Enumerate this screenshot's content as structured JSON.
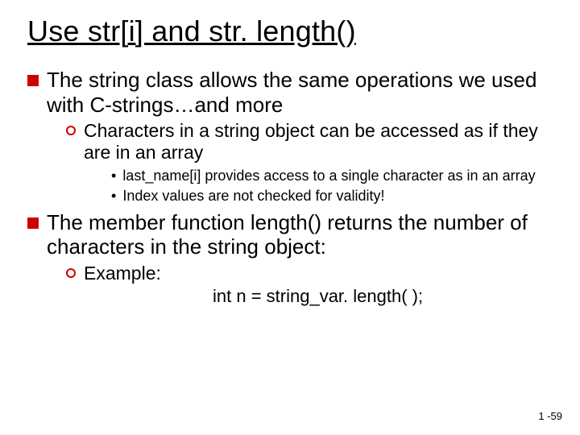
{
  "title": "Use str[i] and str. length()",
  "bullets": {
    "b1": "The string class allows the same operations we used with C-strings…and more",
    "b1a": "Characters in a string object can be accessed as if they are in an array",
    "b1a1_pre": "last_name",
    "b1a1_idx": "[i]",
    "b1a1_post": "  provides access to a single character as in an array",
    "b1a2": "Index values are not checked for validity!",
    "b2_pre": "The member function ",
    "b2_fn": "length()",
    "b2_post": " returns the number of characters in the string object:",
    "b2a": "Example:",
    "code": "int n = string_var. length( );"
  },
  "pagenum": "1 -59",
  "accent_color": "#cc0000"
}
